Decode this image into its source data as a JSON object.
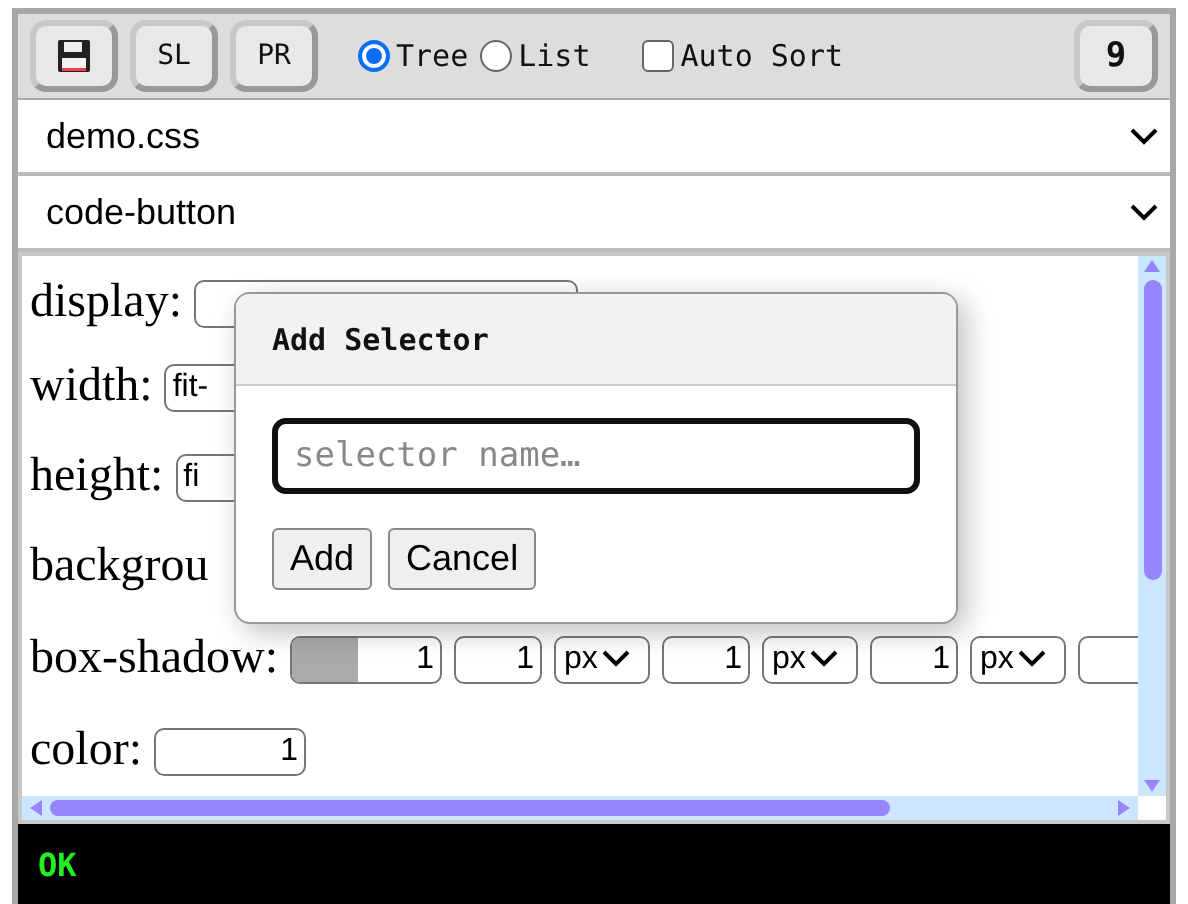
{
  "toolbar": {
    "buttons": [
      {
        "kind": "icon"
      },
      {
        "kind": "text",
        "label": "SL"
      },
      {
        "kind": "text",
        "label": "PR"
      }
    ],
    "view_modes": [
      {
        "label": "Tree",
        "selected": true
      },
      {
        "label": "List",
        "selected": false
      }
    ],
    "auto_sort": {
      "label": "Auto Sort",
      "checked": false
    },
    "count_button": "9"
  },
  "file_select": "demo.css",
  "selector_select": "code-button",
  "properties": [
    {
      "name": "display:",
      "kind": "text"
    },
    {
      "name": "width:",
      "kind": "text",
      "value": "fit-"
    },
    {
      "name": "height:",
      "kind": "text",
      "value": "fi"
    },
    {
      "name": "backgrou",
      "kind": "none"
    },
    {
      "name": "box-shadow:",
      "kind": "shadow",
      "level": 0.45,
      "values": [
        {
          "value": "1"
        },
        {
          "value": "1",
          "unit": "px"
        },
        {
          "value": "1",
          "unit": "px"
        },
        {
          "value": "1",
          "unit": "px"
        }
      ],
      "blank_field": true
    },
    {
      "name": "color:",
      "kind": "number",
      "value": "1"
    }
  ],
  "dialog": {
    "title": "Add Selector",
    "placeholder": "selector name…",
    "buttons": [
      "Add",
      "Cancel"
    ]
  },
  "status_bar": "OK"
}
